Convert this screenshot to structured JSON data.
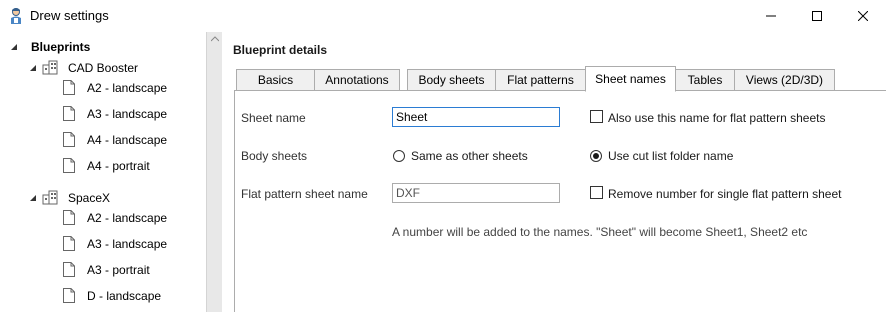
{
  "window": {
    "title": "Drew settings",
    "icon": "drew-app-icon",
    "controls": [
      "minimize-icon",
      "maximize-icon",
      "close-icon"
    ]
  },
  "tree": {
    "root": "Blueprints",
    "groups": [
      {
        "name": "CAD Booster",
        "items": [
          "A2 - landscape",
          "A3 - landscape",
          "A4 - landscape",
          "A4 - portrait"
        ]
      },
      {
        "name": "SpaceX",
        "items": [
          "A2 - landscape",
          "A3 - landscape",
          "A3 - portrait",
          "D - landscape"
        ]
      }
    ]
  },
  "details": {
    "heading": "Blueprint details",
    "tabs": [
      "Basics",
      "Annotations",
      "Body sheets",
      "Flat patterns",
      "Sheet names",
      "Tables",
      "Views (2D/3D)"
    ],
    "active_tab": "Sheet names",
    "sheet_name_label": "Sheet name",
    "sheet_name_value": "Sheet",
    "also_use_label": "Also use this name for flat pattern sheets",
    "also_use_checked": false,
    "body_sheets_label": "Body sheets",
    "radio_same_label": "Same as other sheets",
    "radio_cutlist_label": "Use cut list folder name",
    "body_sheets_selected": "Use cut list folder name",
    "flat_name_label": "Flat pattern sheet name",
    "flat_name_value": "DXF",
    "remove_number_label": "Remove number for single flat pattern sheet",
    "remove_number_checked": false,
    "note": "A number will be added to the names. \"Sheet\" will become Sheet1, Sheet2 etc"
  }
}
